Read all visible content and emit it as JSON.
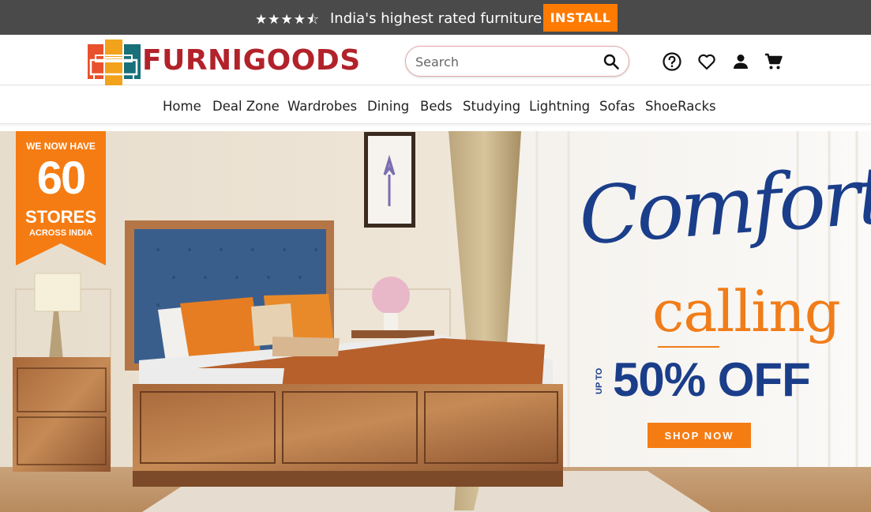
{
  "topbar": {
    "stars": "★★★★⯪",
    "tagline": "India's highest rated furniture app",
    "install_label": "INSTALL"
  },
  "header": {
    "logo_text": "FURNIGOODS",
    "search_placeholder": "Search",
    "icons": [
      "help-icon",
      "wishlist-heart-icon",
      "account-icon",
      "cart-icon"
    ]
  },
  "nav": {
    "items": [
      "Home",
      "Deal Zone",
      "Wardrobes",
      "Dining",
      "Beds",
      "Studying",
      "Lightning",
      "Sofas",
      "ShoeRacks"
    ]
  },
  "banner": {
    "ribbon_line1": "WE NOW HAVE",
    "ribbon_number": "60",
    "ribbon_line3": "STORES",
    "ribbon_line4": "ACROSS INDIA",
    "headline_script": "Comfort",
    "headline_word": "calling",
    "upto": "UP TO",
    "offer": "50% OFF",
    "cta": "SHOP NOW"
  },
  "colors": {
    "topbar_bg": "#4a4a4a",
    "accent_orange": "#ff7a00",
    "brand_red": "#b2222a",
    "banner_navy": "#1b3e8a"
  }
}
